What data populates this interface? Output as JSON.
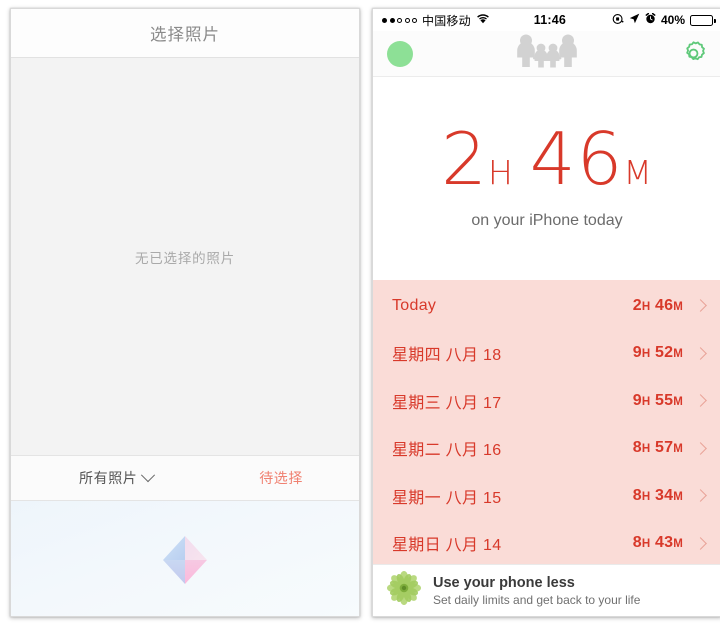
{
  "left_panel": {
    "name": "photo-picker",
    "navbar": {
      "title": "选择照片"
    },
    "body": {
      "empty_message": "无已选择的照片"
    },
    "toolbar": {
      "album_label": "所有照片",
      "album_chevron_icon": "chevron-down-icon",
      "action_label": "待选择",
      "action_color": "#f08070"
    },
    "preview": {
      "icon": "diamond-gem-icon",
      "background_color": "#eef5fb"
    }
  },
  "right_panel": {
    "name": "moment-screen-time-app",
    "statusbar": {
      "signal_dots": [
        true,
        true,
        false,
        false,
        false
      ],
      "carrier": "中国移动",
      "wifi_icon": "wifi-icon",
      "time": "11:46",
      "rotation_lock_icon": "rotation-lock-icon",
      "location_icon": "location-arrow-icon",
      "alarm_icon": "alarm-clock-icon",
      "battery_percent": "40%",
      "battery_level": 40
    },
    "header": {
      "avatar": "avatar-green-dot",
      "avatar_color": "#8de096",
      "family_icon": "family-icon",
      "gear_icon": "gear-icon",
      "gear_color": "#5fc97a"
    },
    "hero": {
      "hours": "2",
      "hours_unit": "H",
      "minutes": "46",
      "minutes_unit": "M",
      "subtitle": "on your iPhone today",
      "accent_color": "#d8392a"
    },
    "day_list": {
      "background_color": "#fadcd7",
      "text_color": "#d8392a",
      "chevron_icon": "chevron-right-icon",
      "rows": [
        {
          "label": "Today",
          "hours": "2",
          "hours_unit": "H",
          "minutes": "46",
          "minutes_unit": "M"
        },
        {
          "label": "星期四 八月 18",
          "hours": "9",
          "hours_unit": "H",
          "minutes": "52",
          "minutes_unit": "M"
        },
        {
          "label": "星期三 八月 17",
          "hours": "9",
          "hours_unit": "H",
          "minutes": "55",
          "minutes_unit": "M"
        },
        {
          "label": "星期二 八月 16",
          "hours": "8",
          "hours_unit": "H",
          "minutes": "57",
          "minutes_unit": "M"
        },
        {
          "label": "星期一 八月 15",
          "hours": "8",
          "hours_unit": "H",
          "minutes": "34",
          "minutes_unit": "M"
        },
        {
          "label": "星期日 八月 14",
          "hours": "8",
          "hours_unit": "H",
          "minutes": "43",
          "minutes_unit": "M"
        }
      ]
    },
    "promo": {
      "icon": "flower-icon",
      "icon_color": "#a8cf65",
      "title": "Use your phone less",
      "subtitle": "Set daily limits and get back to your life"
    }
  }
}
